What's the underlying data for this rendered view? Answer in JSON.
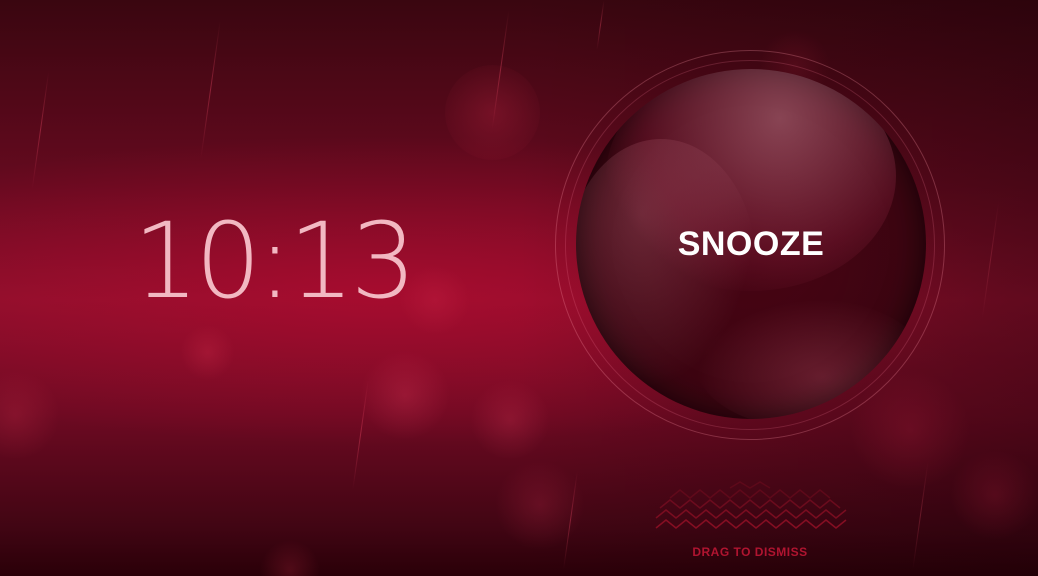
{
  "clock": {
    "time": "10:13"
  },
  "snooze": {
    "label": "SNOOZE"
  },
  "dismiss": {
    "label": "DRAG TO DISMISS"
  },
  "colors": {
    "background_dark": "#2a0008",
    "background_mid": "#8a0f2b",
    "clock_text": "#f2b8c2",
    "snooze_text": "#ffffff",
    "dismiss_text": "#b01430"
  },
  "icons": {
    "dismiss_indicator": "chevron-up-icon"
  }
}
